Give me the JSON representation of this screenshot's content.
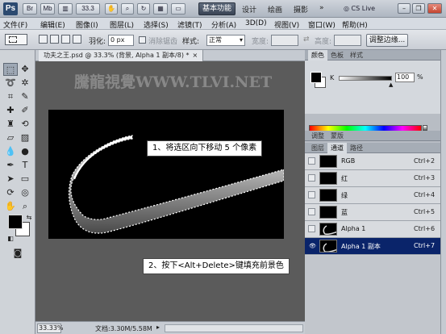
{
  "titlebar": {
    "logo": "Ps",
    "buttons": [
      "Br",
      "Mb"
    ],
    "zoom": "33.3",
    "workspaces": [
      "基本功能",
      "设计",
      "绘画",
      "摄影",
      "»"
    ],
    "cslive": "CS Live"
  },
  "menu": [
    "文件(F)",
    "编辑(E)",
    "图像(I)",
    "图层(L)",
    "选择(S)",
    "滤镜(T)",
    "分析(A)",
    "3D(D)",
    "视图(V)",
    "窗口(W)",
    "帮助(H)"
  ],
  "options": {
    "feather_label": "羽化:",
    "feather_value": "0 px",
    "antialias_label": "消除锯齿",
    "style_label": "样式:",
    "style_value": "正常",
    "width_label": "宽度:",
    "height_label": "高度:",
    "refine_button": "调整边缘..."
  },
  "document": {
    "tab_title": "功夫之王.psd @ 33.3% (背景, Alpha 1 副本/8) *",
    "watermark": "騰龍視覺WWW.TLVI.NET",
    "zoom": "33.33%",
    "doc_size": "文档:3.30M/5.58M"
  },
  "callouts": {
    "step1": "1、将选区向下移动 5 个像素",
    "step2": "2、按下<Alt+Delete>键填充前景色"
  },
  "color_panel": {
    "tabs": [
      "颜色",
      "色板",
      "样式"
    ],
    "k_label": "K",
    "k_value": "100",
    "k_unit": "%"
  },
  "adjust_tabs": [
    "调整",
    "蒙版"
  ],
  "channels_tabs": [
    "图层",
    "通道",
    "路径"
  ],
  "channels": [
    {
      "name": "RGB",
      "shortcut": "Ctrl+2"
    },
    {
      "name": "红",
      "shortcut": "Ctrl+3"
    },
    {
      "name": "绿",
      "shortcut": "Ctrl+4"
    },
    {
      "name": "蓝",
      "shortcut": "Ctrl+5"
    },
    {
      "name": "Alpha 1",
      "shortcut": "Ctrl+6"
    },
    {
      "name": "Alpha 1 副本",
      "shortcut": "Ctrl+7"
    }
  ],
  "selected_channel": "Alpha 1 副本"
}
